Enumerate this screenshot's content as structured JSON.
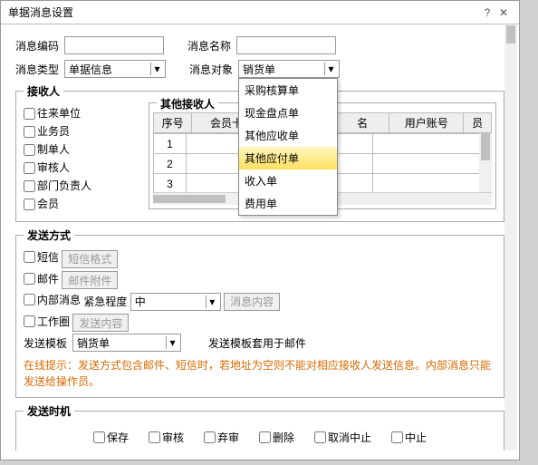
{
  "dialog": {
    "title": "单据消息设置"
  },
  "fields": {
    "code_lbl": "消息编码",
    "code_val": "",
    "name_lbl": "消息名称",
    "name_val": "",
    "type_lbl": "消息类型",
    "type_val": "单据信息",
    "target_lbl": "消息对象",
    "target_val": "销货单"
  },
  "target_options": [
    "采购核算单",
    "现金盘点单",
    "其他应收单",
    "其他应付单",
    "收入单",
    "费用单"
  ],
  "target_hl_index": 3,
  "recipients": {
    "legend": "接收人",
    "items": [
      "往来单位",
      "业务员",
      "制单人",
      "审核人",
      "部门负责人",
      "会员"
    ],
    "others_legend": "其他接收人",
    "cols": [
      "序号",
      "会员卡号",
      "",
      "",
      "名",
      "用户账号",
      "员"
    ]
  },
  "send": {
    "legend": "发送方式",
    "sms": "短信",
    "sms_btn": "短信格式",
    "mail": "邮件",
    "mail_btn": "邮件附件",
    "internal": "内部消息",
    "internal_lvl_lbl": "紧急程度",
    "internal_lvl_val": "中",
    "internal_btn": "消息内容",
    "circle": "工作圈",
    "circle_btn": "发送内容",
    "tpl_lbl": "发送模板",
    "tpl_val": "销货单",
    "tpl_note": "发送模板套用于邮件",
    "hint": "在线提示：发送方式包含邮件、短信时，若地址为空则不能对相应接收人发送信息。内部消息只能发送给操作员。"
  },
  "timing": {
    "legend": "发送时机",
    "opts": [
      "保存",
      "审核",
      "弃审",
      "删除",
      "取消中止",
      "中止"
    ]
  }
}
